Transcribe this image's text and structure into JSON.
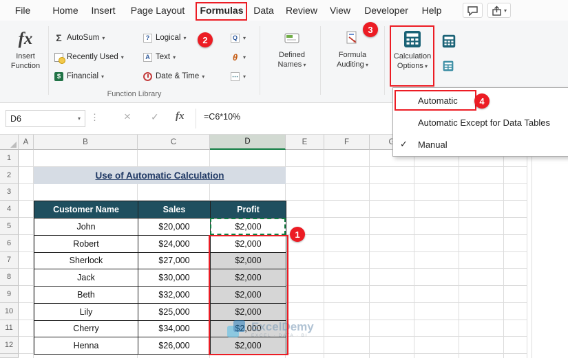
{
  "window": {
    "tabs": [
      "File",
      "Home",
      "Insert",
      "Page Layout",
      "Formulas",
      "Data",
      "Review",
      "View",
      "Developer",
      "Help"
    ],
    "active_tab": "Formulas"
  },
  "ribbon": {
    "insert_function": "Insert Function",
    "autosum": "AutoSum",
    "recently_used": "Recently Used",
    "financial": "Financial",
    "logical": "Logical",
    "text": "Text",
    "date_time": "Date & Time",
    "defined_names": "Defined Names",
    "formula_auditing": "Formula Auditing",
    "calculation_options": "Calculation Options",
    "group_label": "Function Library"
  },
  "menu": {
    "items": [
      {
        "label": "Automatic",
        "checked": false
      },
      {
        "label": "Automatic Except for Data Tables",
        "checked": false
      },
      {
        "label": "Manual",
        "checked": true
      }
    ]
  },
  "formula_bar": {
    "name_box": "D6",
    "formula": "=C6*10%"
  },
  "sheet": {
    "columns": [
      "A",
      "B",
      "C",
      "D",
      "E",
      "F",
      "G"
    ],
    "selected_column": "D",
    "rows": [
      "1",
      "2",
      "3",
      "4",
      "5",
      "6",
      "7",
      "8",
      "9",
      "10",
      "11",
      "12"
    ],
    "title": "Use of Automatic Calculation",
    "active_cell": "D6",
    "table": {
      "headers": [
        "Customer Name",
        "Sales",
        "Profit"
      ],
      "rows": [
        [
          "John",
          "$20,000",
          "$2,000"
        ],
        [
          "Robert",
          "$24,000",
          "$2,000"
        ],
        [
          "Sherlock",
          "$27,000",
          "$2,000"
        ],
        [
          "Jack",
          "$30,000",
          "$2,000"
        ],
        [
          "Beth",
          "$32,000",
          "$2,000"
        ],
        [
          "Lily",
          "$25,000",
          "$2,000"
        ],
        [
          "Cherry",
          "$34,000",
          "$2,000"
        ],
        [
          "Henna",
          "$26,000",
          "$2,000"
        ]
      ]
    }
  },
  "annotations": {
    "badges": [
      "1",
      "2",
      "3",
      "4"
    ],
    "color": "#EC1C24"
  },
  "watermark": {
    "name": "ExcelDemy",
    "tagline": "EXCEL · DATA · BI"
  },
  "colors": {
    "table_header_bg": "#1F4F5F",
    "title_bg": "#D6DCE4",
    "title_text": "#1F3864",
    "selection_fill": "#D6D6D6",
    "excel_green": "#107C41",
    "annotation_red": "#EC1C24"
  }
}
